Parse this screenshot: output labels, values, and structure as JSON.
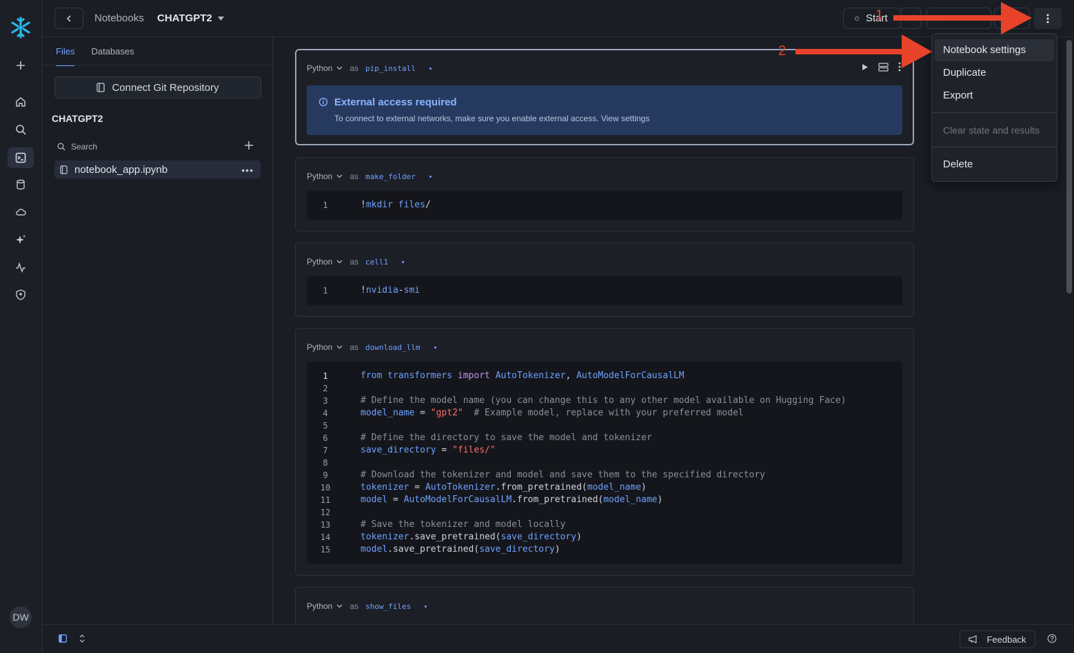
{
  "colors": {
    "accent": "#6fa1ff",
    "arrow": "#e8432a",
    "notice_bg": "#263a60"
  },
  "header": {
    "crumb": "Notebooks",
    "notebook_name": "CHATGPT2",
    "start_label": "Start"
  },
  "files_panel": {
    "tabs": [
      {
        "label": "Files"
      },
      {
        "label": "Databases"
      }
    ],
    "git_button": "Connect Git Repository",
    "project_name": "CHATGPT2",
    "search_placeholder": "Search",
    "files": [
      {
        "name": "notebook_app.ipynb"
      }
    ]
  },
  "cells": [
    {
      "lang": "Python",
      "as": "as",
      "name": "pip_install",
      "notice": {
        "title": "External access required",
        "text": "To connect to external networks, make sure you enable external access. View settings"
      }
    },
    {
      "lang": "Python",
      "as": "as",
      "name": "make_folder",
      "lines": [
        "!mkdir files/"
      ]
    },
    {
      "lang": "Python",
      "as": "as",
      "name": "cell1",
      "lines": [
        "!nvidia-smi"
      ]
    },
    {
      "lang": "Python",
      "as": "as",
      "name": "download_llm",
      "lines": [
        "from transformers import AutoTokenizer, AutoModelForCausalLM",
        "",
        "# Define the model name (you can change this to any other model available on Hugging Face)",
        "model_name = \"gpt2\"  # Example model, replace with your preferred model",
        "",
        "# Define the directory to save the model and tokenizer",
        "save_directory = \"files/\"",
        "",
        "# Download the tokenizer and model and save them to the specified directory",
        "tokenizer = AutoTokenizer.from_pretrained(model_name)",
        "model = AutoModelForCausalLM.from_pretrained(model_name)",
        "",
        "# Save the tokenizer and model locally",
        "tokenizer.save_pretrained(save_directory)",
        "model.save_pretrained(save_directory)"
      ]
    },
    {
      "lang": "Python",
      "as": "as",
      "name": "show_files"
    }
  ],
  "line_numbers": [
    "1",
    "2",
    "3",
    "4",
    "5",
    "6",
    "7",
    "8",
    "9",
    "10",
    "11",
    "12",
    "13",
    "14",
    "15"
  ],
  "menu": {
    "items": [
      {
        "label": "Notebook settings"
      },
      {
        "label": "Duplicate"
      },
      {
        "label": "Export"
      },
      {
        "label": "Clear state and results"
      },
      {
        "label": "Delete"
      }
    ]
  },
  "annotations": {
    "step1": "1",
    "step2": "2"
  },
  "user": {
    "initials": "DW"
  },
  "footer": {
    "feedback_label": "Feedback"
  }
}
